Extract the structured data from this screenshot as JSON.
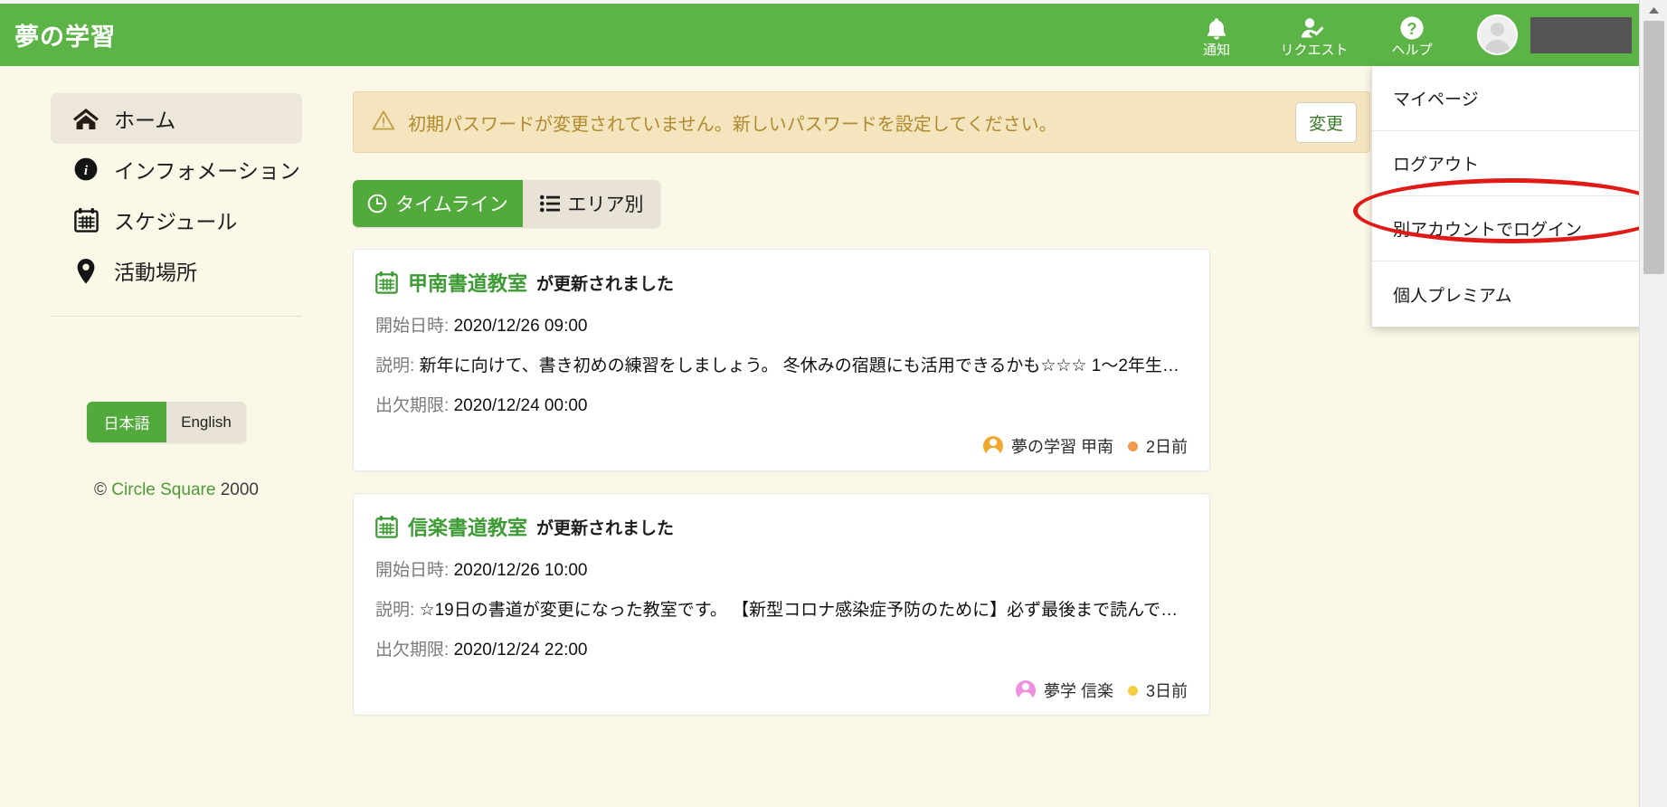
{
  "header": {
    "brand": "夢の学習",
    "nav": [
      {
        "icon": "bell-icon",
        "label": "通知"
      },
      {
        "icon": "user-check-icon",
        "label": "リクエスト"
      },
      {
        "icon": "question-circle-icon",
        "label": "ヘルプ"
      }
    ],
    "account": {
      "avatar_alt": "user-avatar",
      "name_redacted": ""
    },
    "bar_color": "#5cb446"
  },
  "dropdown": {
    "open": true,
    "items": [
      {
        "label": "マイページ",
        "highlighted": false
      },
      {
        "label": "ログアウト",
        "highlighted": false
      },
      {
        "label": "別アカウントでログイン",
        "highlighted": true
      },
      {
        "label": "個人プレミアム",
        "highlighted": false
      }
    ],
    "annotation_color": "#e01b17"
  },
  "sidebar": {
    "items": [
      {
        "icon": "home-icon",
        "label": "ホーム",
        "active": true
      },
      {
        "icon": "info-circle-icon",
        "label": "インフォメーション",
        "active": false
      },
      {
        "icon": "calendar-icon",
        "label": "スケジュール",
        "active": false
      },
      {
        "icon": "map-pin-icon",
        "label": "活動場所",
        "active": false
      }
    ],
    "language": {
      "selected": "日本語",
      "options": [
        "日本語",
        "English"
      ]
    },
    "copyright": {
      "symbol": "©",
      "name": "Circle Square",
      "year": "2000"
    }
  },
  "main": {
    "alert": {
      "icon": "warning-triangle-icon",
      "message": "初期パスワードが変更されていません。新しいパスワードを設定してください。",
      "button": "変更",
      "bg_color": "#f4e5bf",
      "text_color": "#b08a2e"
    },
    "tabs": [
      {
        "icon": "clock-icon",
        "label": "タイムライン",
        "active": true
      },
      {
        "icon": "list-icon",
        "label": "エリア別",
        "active": false
      }
    ],
    "labels": {
      "start": "開始日時:",
      "description": "説明:",
      "deadline": "出欠期限:"
    },
    "cards": [
      {
        "icon": "calendar-icon",
        "group": "甲南書道教室",
        "suffix": "が更新されました",
        "start": "2020/12/26 09:00",
        "description": "新年に向けて、書き初めの練習をしましょう。 冬休みの宿題にも活用できるかも☆☆☆ 1〜2年生は…",
        "deadline": "2020/12/24 00:00",
        "author": "夢の学習 甲南",
        "author_color": "#f0a92e",
        "dot_color": "#f09a4e",
        "ago": "2日前"
      },
      {
        "icon": "calendar-icon",
        "group": "信楽書道教室",
        "suffix": "が更新されました",
        "start": "2020/12/26 10:00",
        "description": "☆19日の書道が変更になった教室です。 【新型コロナ感染症予防のために】必ず最後まで読んでく…",
        "deadline": "2020/12/24 22:00",
        "author": "夢学 信楽",
        "author_color": "#f08fe0",
        "dot_color": "#f2cf3e",
        "ago": "3日前"
      }
    ]
  },
  "scrollbar": {
    "arrow_up": "scroll-up-arrow"
  }
}
